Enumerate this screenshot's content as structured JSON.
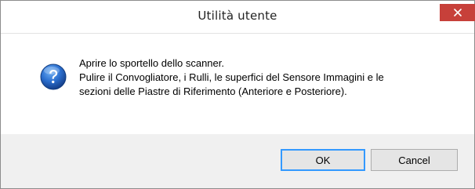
{
  "window": {
    "title": "Utilità utente",
    "close_icon": "close-icon"
  },
  "message": {
    "icon": "question-icon",
    "lines": [
      "Aprire lo sportello dello scanner.",
      "Pulire il Convogliatore, i Rulli, le superfici del Sensore Immagini e le",
      "sezioni delle Piastre di Riferimento (Anteriore e Posteriore)."
    ]
  },
  "buttons": {
    "ok_label": "OK",
    "cancel_label": "Cancel"
  },
  "colors": {
    "close_button": "#c7403a",
    "icon_blue": "#1f5fb8",
    "default_button_border": "#3399ff"
  }
}
